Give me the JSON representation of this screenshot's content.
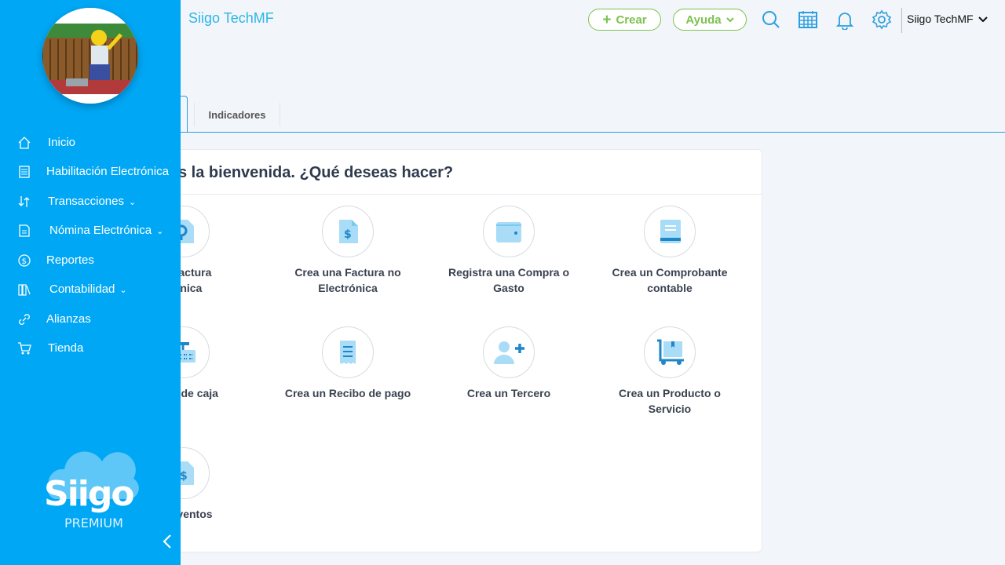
{
  "header": {
    "company": "Siigo TechMF",
    "create_label": "Crear",
    "help_label": "Ayuda",
    "user_name": "Siigo TechMF",
    "icons": [
      "search-icon",
      "calendar-icon",
      "bell-icon",
      "gear-icon"
    ]
  },
  "tabs": [
    {
      "label": ""
    },
    {
      "label": "Indicadores"
    }
  ],
  "panel": {
    "title": "s la bienvenida. ¿Qué deseas hacer?",
    "actions": [
      {
        "label": "na Factura\ntrónica",
        "icon": "invoice-electronic-icon"
      },
      {
        "label": "Crea una Factura no\nElectrónica",
        "icon": "invoice-dollar-icon"
      },
      {
        "label": "Registra una Compra o\nGasto",
        "icon": "wallet-icon"
      },
      {
        "label": "Crea un Comprobante\ncontable",
        "icon": "ledger-book-icon"
      },
      {
        "label": "ecibo de caja",
        "icon": "cash-register-icon"
      },
      {
        "label": "Crea un Recibo de pago",
        "icon": "receipt-icon"
      },
      {
        "label": "Crea un Tercero",
        "icon": "add-user-icon"
      },
      {
        "label": "Crea un Producto o\nServicio",
        "icon": "product-cart-icon"
      },
      {
        "label": "de eventos",
        "icon": "event-document-icon"
      }
    ]
  },
  "sidebar": {
    "items": [
      {
        "label": "Inicio",
        "icon": "home-icon",
        "has_submenu": false
      },
      {
        "label": "Habilitación Electrónica",
        "icon": "document-icon",
        "has_submenu": false
      },
      {
        "label": "Transacciones",
        "icon": "transactions-icon",
        "has_submenu": true
      },
      {
        "label": "Nómina Electrónica",
        "icon": "payroll-icon",
        "has_submenu": true
      },
      {
        "label": "Reportes",
        "icon": "reports-icon",
        "has_submenu": false
      },
      {
        "label": "Contabilidad",
        "icon": "accounting-icon",
        "has_submenu": true
      },
      {
        "label": "Alianzas",
        "icon": "link-icon",
        "has_submenu": false
      },
      {
        "label": "Tienda",
        "icon": "cart-icon",
        "has_submenu": false
      }
    ],
    "logo_text": "Siigo",
    "logo_subtext": "PREMIUM"
  },
  "colors": {
    "sidebar": "#00a7f5",
    "accent_green": "#7bc24f",
    "accent_blue": "#2cb6e8",
    "icon_light": "#a9dcf7",
    "icon_dark": "#1f86c8"
  }
}
